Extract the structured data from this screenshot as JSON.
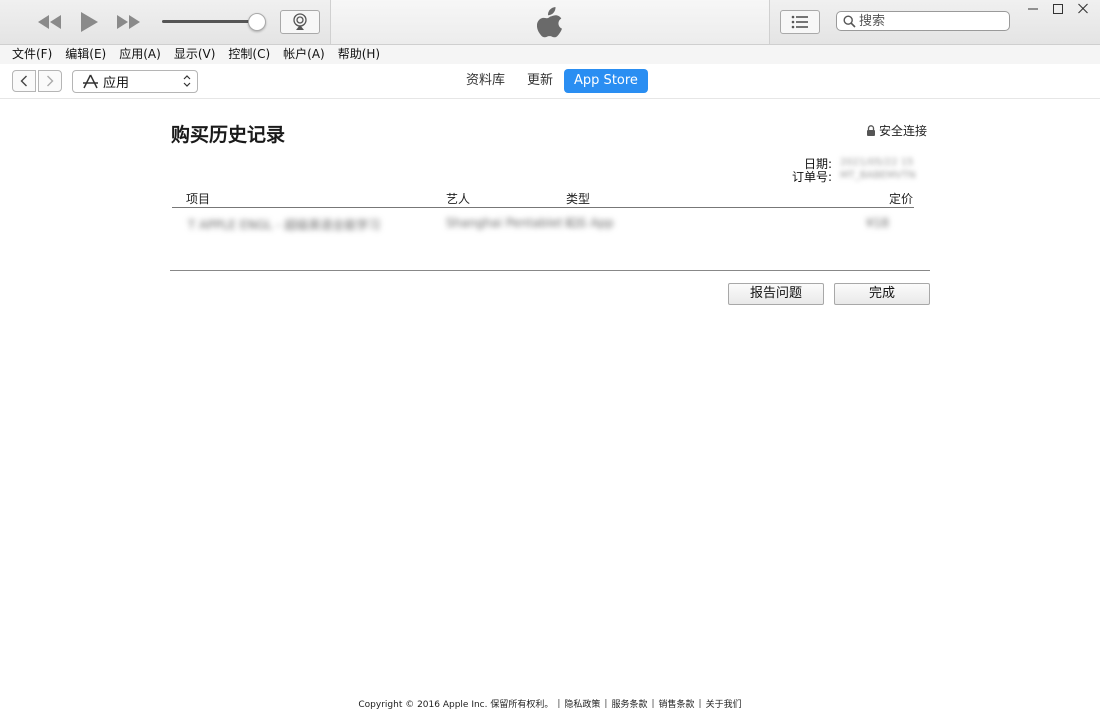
{
  "search": {
    "placeholder": "搜索"
  },
  "menu": [
    "文件(F)",
    "编辑(E)",
    "应用(A)",
    "显示(V)",
    "控制(C)",
    "帐户(A)",
    "帮助(H)"
  ],
  "nav": {
    "media_selector": "应用",
    "tabs": [
      "资料库",
      "更新",
      "App Store"
    ],
    "active_tab": "App Store"
  },
  "page": {
    "title": "购买历史记录",
    "secure_label": "安全连接",
    "date_label": "日期:",
    "date_value": "2021/05/22 15",
    "order_label": "订单号:",
    "order_value": "MT_BABEMVTN",
    "columns": {
      "item": "项目",
      "artist": "艺人",
      "type": "类型",
      "price": "定价"
    },
    "rows": [
      {
        "item": "T APPLE ENGL - 超级英语全能学习",
        "artist": "Shanghai Pentablet I...",
        "type": "iOS App",
        "price": "¥18"
      }
    ],
    "buttons": {
      "report": "报告问题",
      "done": "完成"
    }
  },
  "footer": {
    "copyright": "Copyright © 2016 Apple Inc. 保留所有权利。",
    "links": [
      "隐私政策",
      "服务条款",
      "销售条款",
      "关于我们"
    ]
  },
  "colors": {
    "accent": "#2a8ef2"
  }
}
